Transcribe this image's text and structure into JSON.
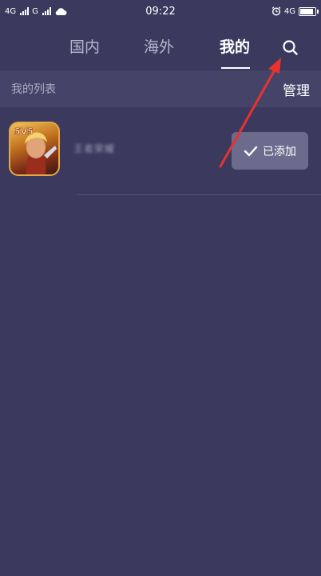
{
  "status_bar": {
    "net1": "4G",
    "net2": "G",
    "time": "09:22",
    "right_net": "4G"
  },
  "tabs": [
    {
      "label": "国内",
      "active": false
    },
    {
      "label": "海外",
      "active": false
    },
    {
      "label": "我的",
      "active": true
    }
  ],
  "list": {
    "title": "我的列表",
    "manage_label": "管理"
  },
  "game": {
    "badge_text": "5V5",
    "name": "王者荣耀",
    "added_label": "已添加"
  },
  "colors": {
    "background": "#3b3a5e",
    "header_band": "#454468",
    "button": "#6c6b8e",
    "annotation_arrow": "#e8322e"
  },
  "icons": [
    "signal-icon",
    "cloud-icon",
    "alarm-icon",
    "battery-icon",
    "search-icon",
    "check-icon",
    "annotation-arrow"
  ]
}
